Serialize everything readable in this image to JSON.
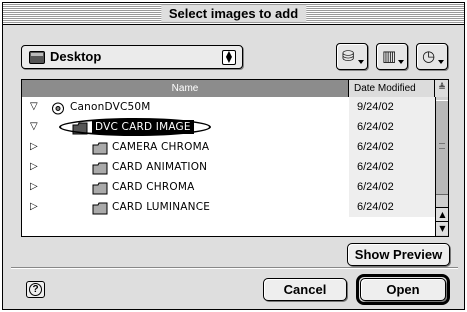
{
  "window": {
    "title": "Select images to add"
  },
  "location": {
    "selected": "Desktop"
  },
  "toolbar": {
    "buttons": [
      {
        "icon": "disk-volume-icon"
      },
      {
        "icon": "favorites-book-icon"
      },
      {
        "icon": "recent-clock-icon"
      }
    ]
  },
  "list": {
    "columns": {
      "name": "Name",
      "date": "Date Modified"
    },
    "rows": [
      {
        "name": "CanonDVC50M",
        "date": "9/24/02",
        "disclosure": "▽",
        "indent": 0,
        "icon": "camera-volume-icon",
        "selected": false
      },
      {
        "name": "DVC CARD IMAGE",
        "date": "6/24/02",
        "disclosure": "▽",
        "indent": 1,
        "icon": "folder-icon",
        "selected": true
      },
      {
        "name": "CAMERA CHROMA",
        "date": "6/24/02",
        "disclosure": "▷",
        "indent": 2,
        "icon": "folder-icon",
        "selected": false
      },
      {
        "name": "CARD ANIMATION",
        "date": "6/24/02",
        "disclosure": "▷",
        "indent": 2,
        "icon": "folder-icon",
        "selected": false
      },
      {
        "name": "CARD CHROMA",
        "date": "6/24/02",
        "disclosure": "▷",
        "indent": 2,
        "icon": "folder-icon",
        "selected": false
      },
      {
        "name": "CARD LUMINANCE",
        "date": "6/24/02",
        "disclosure": "▷",
        "indent": 2,
        "icon": "folder-icon",
        "selected": false
      }
    ]
  },
  "buttons": {
    "show_preview": "Show Preview",
    "cancel": "Cancel",
    "open": "Open",
    "help": "?"
  },
  "colors": {
    "header": "#8c8c8c",
    "selection": "#000000",
    "window_bg": "#dedede"
  }
}
